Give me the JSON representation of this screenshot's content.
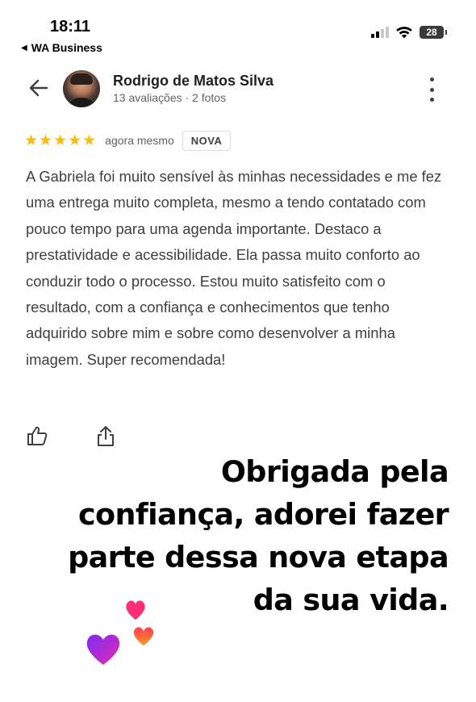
{
  "status_bar": {
    "time": "18:11",
    "back_app": "WA Business",
    "battery": "28"
  },
  "review": {
    "reviewer_name": "Rodrigo de Matos Silva",
    "reviewer_meta": "13 avaliações · 2 fotos",
    "stars": "★★★★★",
    "rating": 5,
    "time_posted": "agora mesmo",
    "badge": "NOVA",
    "text": "A Gabriela foi muito sensível às minhas necessidades e me fez uma entrega muito completa, mesmo a tendo contatado com pouco tempo para uma agenda importante. Destaco a prestatividade e acessibilidade. Ela passa muito conforto ao conduzir todo o processo. Estou muito satisfeito com o resultado, com a confiança e conhecimentos que tenho adquirido sobre mim e sobre como desenvolver a minha imagem. Super recomendada!"
  },
  "overlay": {
    "lines": [
      "Obrigada pela",
      "confiança, adorei fazer",
      "parte dessa nova etapa",
      "da sua vida."
    ]
  },
  "colors": {
    "star": "#fbbc04",
    "heart_pink": "#ff2d78",
    "heart_orange": "#ff6a1a",
    "heart_purple": "#9b2cf0"
  },
  "icons": [
    "back-arrow-icon",
    "more-vert-icon",
    "thumb-up-icon",
    "share-icon",
    "hearts-sticker-icon"
  ]
}
